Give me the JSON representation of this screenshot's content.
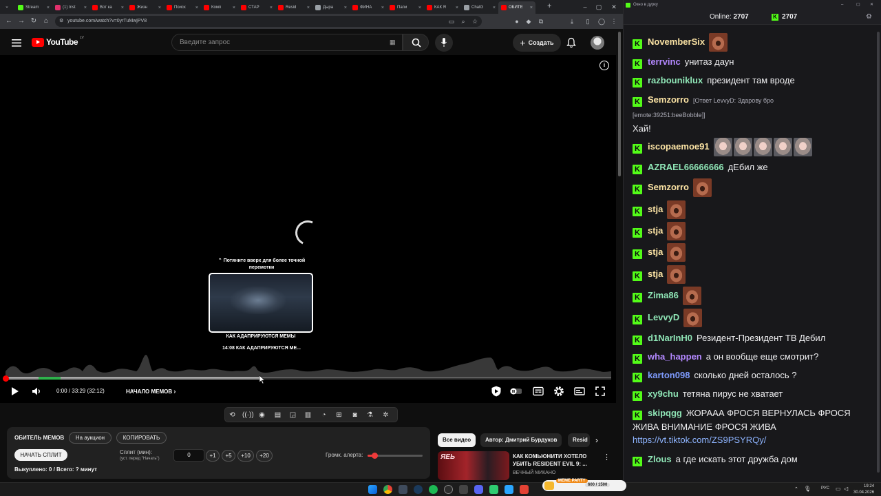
{
  "browser": {
    "tabs": [
      {
        "label": "Stream",
        "color": "#53fc18"
      },
      {
        "label": "(1) Inst",
        "color": "#e1306c"
      },
      {
        "label": "Вот ка",
        "color": "#ff0000"
      },
      {
        "label": "Жизн",
        "color": "#ff0000"
      },
      {
        "label": "Поиск",
        "color": "#ff0000"
      },
      {
        "label": "Комп",
        "color": "#ff0000"
      },
      {
        "label": "СТАР",
        "color": "#ff0000"
      },
      {
        "label": "Resid",
        "color": "#ff0000"
      },
      {
        "label": "Дыра",
        "color": "#9aa0a6"
      },
      {
        "label": "ФИНА",
        "color": "#ff0000"
      },
      {
        "label": "Папи",
        "color": "#ff0000"
      },
      {
        "label": "КАК Я",
        "color": "#ff0000"
      },
      {
        "label": "ChatG",
        "color": "#9aa0a6"
      },
      {
        "label": "ОБИТЕ",
        "color": "#ff0000"
      }
    ],
    "active_tab_index": 13,
    "url": "youtube.com/watch?v=0yrTuMwjPV8"
  },
  "youtube": {
    "logo": "YouTube",
    "country": "LV",
    "search_placeholder": "Введите запрос",
    "create_label": "Создать"
  },
  "player": {
    "seek_hint": "⌃ Потяните вверх для более точной перемотки",
    "thumb_chapter": "КАК АДАПРИРУЮТСЯ МЕМЫ",
    "thumb_time": "14:08   КАК АДАПРИРУЮТСЯ МЕ...",
    "time": "0:00 / 33:29 (32:12)",
    "chapter": "НАЧАЛО МЕМОВ",
    "loaded_fraction": 0.42,
    "played_fraction": 0.0
  },
  "extension_panel": {
    "title": "ОБИТЕЛЬ МЕМОВ",
    "auction_btn": "На аукцион",
    "copy_btn": "КОПИРОВАТЬ",
    "start_split_btn": "НАЧАТЬ СПЛИТ",
    "split_label": "Сплит (мин):",
    "split_hint": "(уст. перед \"Начать\")",
    "split_value": "0",
    "steps": [
      "+1",
      "+5",
      "+10",
      "+20"
    ],
    "alert_volume_label": "Громк. алерта:",
    "alert_volume": 0.12,
    "stats": "Выкуплено: 0 / Всего: ? минут"
  },
  "recommendations": {
    "chips": [
      "Все видео",
      "Автор: Дмитрий Бурдуков",
      "Resid"
    ],
    "video_title": "КАК КОМЬЮНИТИ ХОТЕЛО УБИТЬ RESIDENT EVIL 9: ...",
    "channel": "ВЕЧНЫЙ МИКАНО",
    "thumb_text": "ЯЕЬ"
  },
  "chat": {
    "window_title": "Окно в дурку",
    "online_label": "Online:",
    "online_count": "2707",
    "kick_count": "2707",
    "messages": [
      {
        "user": "NovemberSix",
        "user_color": "#fbe3a4",
        "text": "",
        "emotes": [
          "brown"
        ]
      },
      {
        "user": "terrvinc",
        "user_color": "#b388ff",
        "text": "унитаз даун",
        "emotes": []
      },
      {
        "user": "razbouniklux",
        "user_color": "#8fe5b6",
        "text": "президент там вроде",
        "emotes": []
      },
      {
        "user": "Semzorro",
        "user_color": "#fbe3a4",
        "reply": "[Ответ LevvyD: Здарову бро",
        "reply2": "[emote:39251:beeBobble]]",
        "text": "Хай!",
        "emotes": []
      },
      {
        "user": "iscopaemoe91",
        "user_color": "#fbe3a4",
        "text": "",
        "emotes": [
          "gray",
          "gray",
          "gray",
          "gray",
          "gray"
        ]
      },
      {
        "user": "AZRAEL66666666",
        "user_color": "#8fe5b6",
        "text": "дЕбил же",
        "emotes": []
      },
      {
        "user": "Semzorro",
        "user_color": "#fbe3a4",
        "text": "",
        "emotes": [
          "brown"
        ]
      },
      {
        "user": "stja",
        "user_color": "#fbe3a4",
        "text": "",
        "emotes": [
          "brown"
        ]
      },
      {
        "user": "stja",
        "user_color": "#fbe3a4",
        "text": "",
        "emotes": [
          "brown"
        ]
      },
      {
        "user": "stja",
        "user_color": "#fbe3a4",
        "text": "",
        "emotes": [
          "brown"
        ]
      },
      {
        "user": "stja",
        "user_color": "#fbe3a4",
        "text": "",
        "emotes": [
          "brown"
        ]
      },
      {
        "user": "Zima86",
        "user_color": "#8fe5b6",
        "text": "",
        "emotes": [
          "brown"
        ]
      },
      {
        "user": "LevvyD",
        "user_color": "#8fe5b6",
        "text": "",
        "emotes": [
          "brown"
        ]
      },
      {
        "user": "d1NarInH0",
        "user_color": "#8fe5b6",
        "text": "Резидент-Президент ТВ Дебил",
        "emotes": []
      },
      {
        "user": "wha_happen",
        "user_color": "#b388ff",
        "text": "а он вообще еще смотрит?",
        "emotes": []
      },
      {
        "user": "karton098",
        "user_color": "#7f9cff",
        "text": "сколько дней осталось ?",
        "emotes": []
      },
      {
        "user": "xy9chu",
        "user_color": "#8fe5b6",
        "text": "тетяна пирус не хватает",
        "emotes": []
      },
      {
        "user": "skipqgg",
        "user_color": "#8fe5b6",
        "text": "ЖОРААА ФРОСЯ ВЕРНУЛАСЬ ФРОСЯ ЖИВА ВНИМАНИЕ ФРОСЯ ЖИВА",
        "link": "https://vt.tiktok.com/ZS9PSYRQy/",
        "emotes": []
      },
      {
        "user": "Zlous",
        "user_color": "#8fe5b6",
        "text": "а где искать этот дружба дом",
        "emotes": []
      }
    ]
  },
  "taskbar": {
    "meme_party_label": "MEME PARTY",
    "meme_party_count": "600 / 1500",
    "lang": "РУС",
    "time": "19:24",
    "date": "30.04.2026"
  }
}
